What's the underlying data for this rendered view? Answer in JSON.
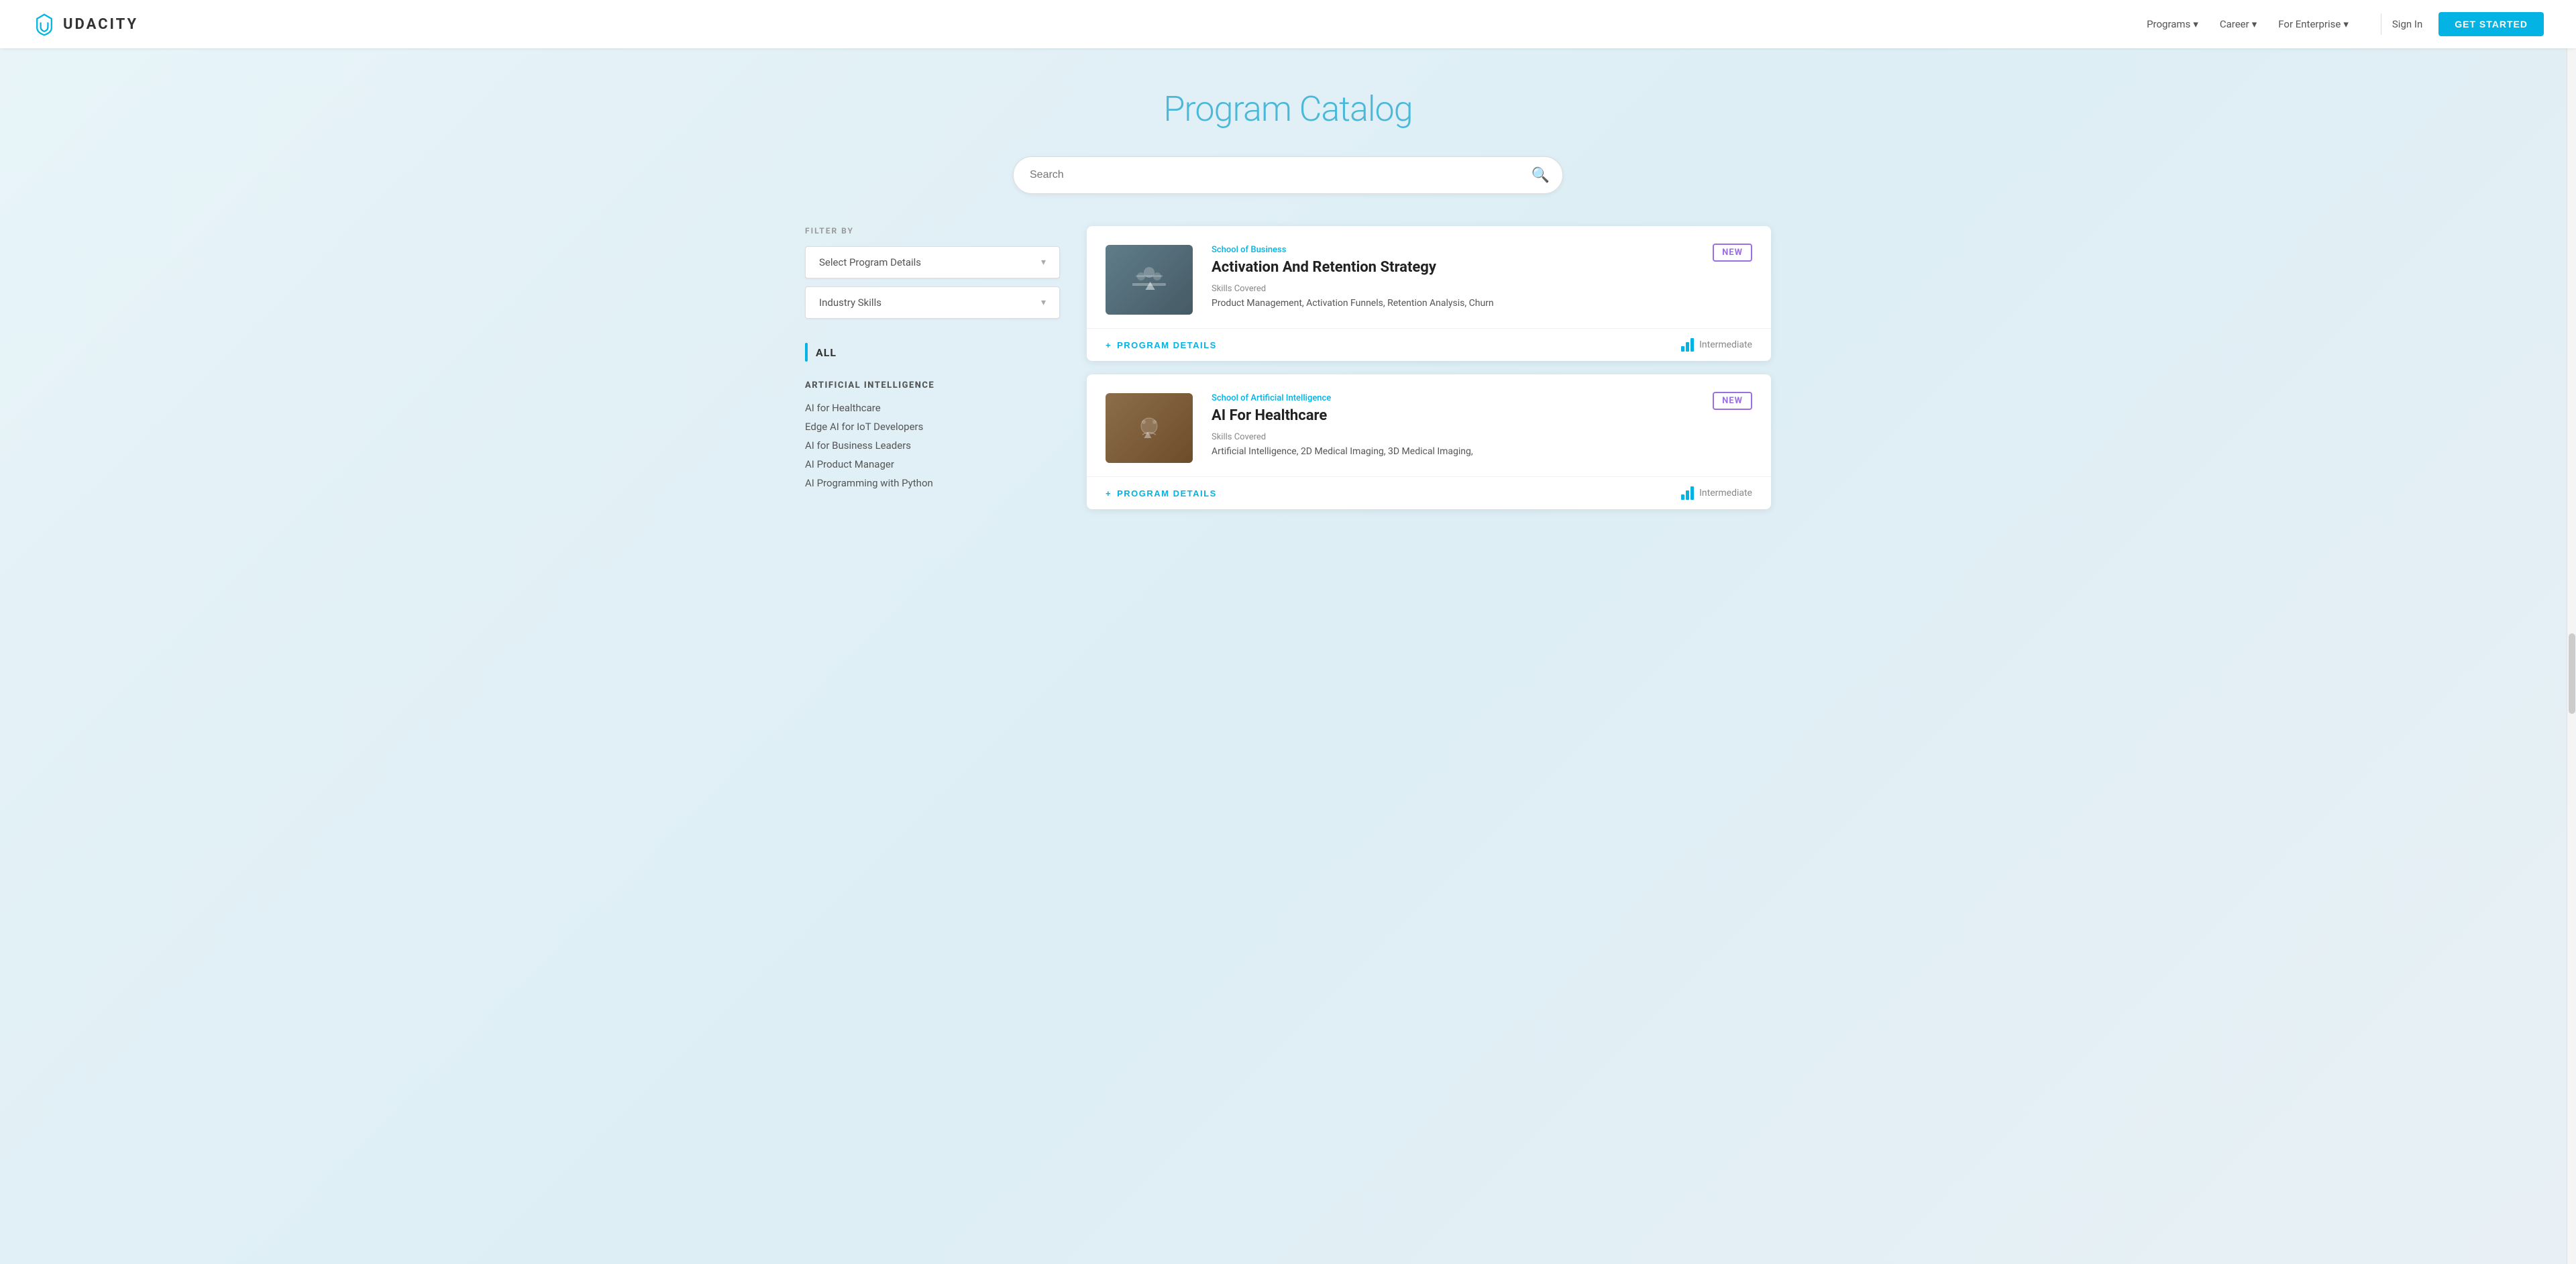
{
  "navbar": {
    "logo_text": "UDACITY",
    "nav_items": [
      {
        "label": "Programs",
        "has_dropdown": true
      },
      {
        "label": "Career",
        "has_dropdown": true
      },
      {
        "label": "For Enterprise",
        "has_dropdown": true
      }
    ],
    "sign_in_label": "Sign In",
    "get_started_label": "GET STARTED"
  },
  "page": {
    "title": "Program Catalog",
    "search_placeholder": "Search"
  },
  "sidebar": {
    "filter_label": "FILTER BY",
    "select_program_label": "Select Program Details",
    "industry_skills_label": "Industry Skills",
    "nav_all_label": "ALL",
    "categories": [
      {
        "title": "ARTIFICIAL INTELLIGENCE",
        "items": [
          "AI for Healthcare",
          "Edge AI for IoT Developers",
          "AI for Business Leaders",
          "AI Product Manager",
          "AI Programming with Python"
        ]
      }
    ]
  },
  "programs": [
    {
      "school": "School of Business",
      "title": "Activation And Retention Strategy",
      "badge": "NEW",
      "skills_label": "Skills Covered",
      "skills": "Product Management, Activation Funnels, Retention Analysis, Churn",
      "level": "Intermediate",
      "thumbnail_type": "business",
      "details_label": "PROGRAM DETAILS"
    },
    {
      "school": "School of Artificial Intelligence",
      "title": "AI For Healthcare",
      "badge": "NEW",
      "skills_label": "Skills Covered",
      "skills": "Artificial Intelligence, 2D Medical Imaging, 3D Medical Imaging,",
      "level": "Intermediate",
      "thumbnail_type": "ai",
      "details_label": "PROGRAM DETAILS"
    }
  ],
  "icons": {
    "search": "🔍",
    "chevron_down": "▾",
    "plus": "+",
    "bar_chart": "📊"
  }
}
